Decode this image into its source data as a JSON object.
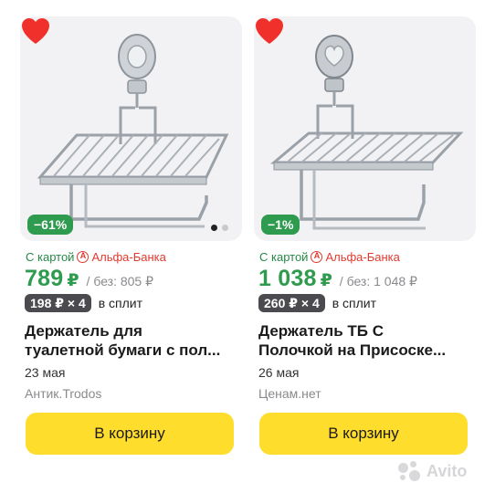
{
  "products": [
    {
      "discount": "−61%",
      "bank_prefix": "С картой",
      "bank_name": "Альфа-Банка",
      "price": "789",
      "currency": "₽",
      "old_price": "/ без: 805 ₽",
      "split_badge": "198 ₽ × 4",
      "split_text": "в сплит",
      "title_line1": "Держатель для",
      "title_line2": "туалетной бумаги с пол...",
      "date": "23 мая",
      "seller": "Антик.Trodos",
      "cart_label": "В корзину",
      "photo_count": 2,
      "photo_active": 0,
      "favorite": true
    },
    {
      "discount": "−1%",
      "bank_prefix": "С картой",
      "bank_name": "Альфа-Банка",
      "price": "1 038",
      "currency": "₽",
      "old_price": "/ без: 1 048 ₽",
      "split_badge": "260 ₽ × 4",
      "split_text": "в сплит",
      "title_line1": "Держатель ТБ С",
      "title_line2": "Полочкой на Присоске...",
      "date": "26 мая",
      "seller": "Ценам.нет",
      "cart_label": "В корзину",
      "photo_count": 1,
      "photo_active": 0,
      "favorite": true
    }
  ],
  "colors": {
    "price_green": "#2e9b4f",
    "bank_red": "#e03a2f",
    "cart_yellow": "#ffdd2d",
    "heart_red": "#f0302a"
  },
  "icons": [
    "heart-icon",
    "alfa-bank-logo-icon",
    "avito-logo"
  ],
  "watermark": "Avito"
}
